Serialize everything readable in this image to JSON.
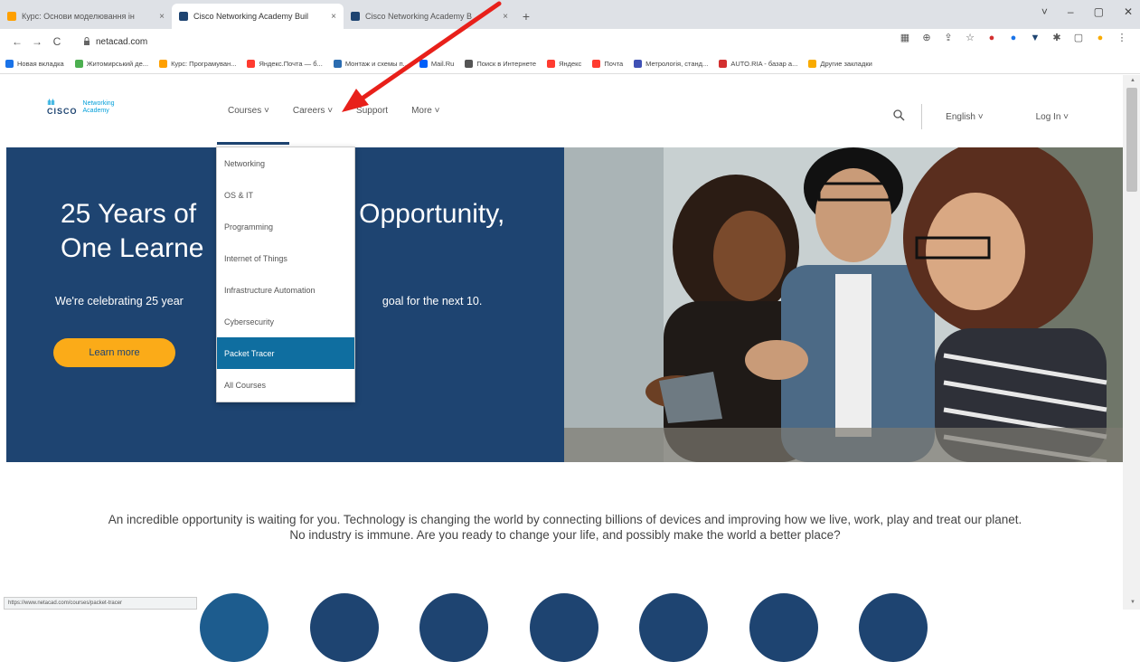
{
  "browser": {
    "tabs": [
      {
        "title": "Курс: Основи моделювання ін",
        "favicon_color": "#ffa000"
      },
      {
        "title": "Cisco Networking Academy Buil",
        "favicon_color": "#1e4471"
      },
      {
        "title": "Cisco Networking Academy B",
        "favicon_color": "#1e4471"
      }
    ],
    "new_tab_label": "+",
    "close_label": "×",
    "window_controls": {
      "minimize": "–",
      "maximize": "▢",
      "close": "✕"
    },
    "url": "netacad.com",
    "bookmarks": [
      {
        "label": "Новая вкладка",
        "color": "#1a73e8"
      },
      {
        "label": "Житомирський де...",
        "color": "#4caf50"
      },
      {
        "label": "Курс: Програмуван...",
        "color": "#ffa000"
      },
      {
        "label": "Яндекс.Почта — б...",
        "color": "#ff3b30"
      },
      {
        "label": "Монтаж и схемы п...",
        "color": "#2b6cb0"
      },
      {
        "label": "Mail.Ru",
        "color": "#005ff9"
      },
      {
        "label": "Поиск в Интернете",
        "color": "#555555"
      },
      {
        "label": "Яндекс",
        "color": "#ff3b30"
      },
      {
        "label": "Почта",
        "color": "#ff3b30"
      },
      {
        "label": "Метрологія, станд...",
        "color": "#3f51b5"
      },
      {
        "label": "AUTO.RIA - базар а...",
        "color": "#d32f2f"
      },
      {
        "label": "Другие закладки",
        "color": "#f9ab00"
      }
    ],
    "status_url": "https://www.netacad.com/courses/packet-tracer"
  },
  "header": {
    "logo_brand": "CISCO",
    "logo_product_line1": "Networking",
    "logo_product_line2": "Academy",
    "nav": [
      "Courses ˅",
      "Careers ˅",
      "Support",
      "More ˅"
    ],
    "language": "English ˅",
    "login": "Log In ˅"
  },
  "dropdown": {
    "items": [
      "Networking",
      "OS & IT",
      "Programming",
      "Internet of Things",
      "Infrastructure Automation",
      "Cybersecurity",
      "Packet Tracer",
      "All Courses"
    ],
    "active_index": 6
  },
  "hero": {
    "title": "25 Years of Opportunity, One Learner at a Time",
    "title_visible_line1": "25 Years of",
    "title_visible_line1b": "Opportunity,",
    "title_visible_line2": "One Learne",
    "title_visible_line2b": "e",
    "subtitle_a": "We're celebrating 25 year",
    "subtitle_b": "goal for the next 10.",
    "button": "Learn more"
  },
  "intro": {
    "text": "An incredible opportunity is waiting for you. Technology is changing the world by connecting billions of devices and improving how we live, work, play and treat our planet. No industry is immune. Are you ready to change your life, and possibly make the world a better place?"
  },
  "colors": {
    "brand_navy": "#1e4471",
    "accent_yellow": "#fbab18",
    "dropdown_active": "#0f6ea0",
    "annotation_arrow": "#e8201a"
  },
  "icons": {
    "back": "←",
    "forward": "→",
    "reload": "C",
    "lock": "🔒",
    "search": "⚲"
  }
}
